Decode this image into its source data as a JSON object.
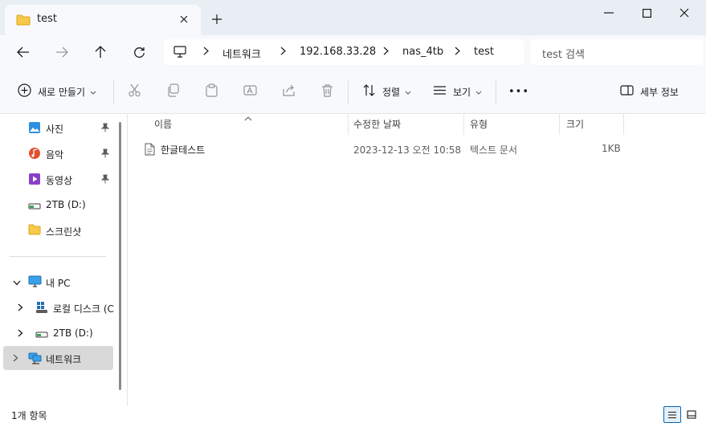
{
  "window": {
    "tab_title": "test",
    "controls": {
      "minimize_icon": "minimize-icon",
      "maximize_icon": "maximize-icon",
      "close_icon": "close-icon"
    }
  },
  "address_bar": {
    "breadcrumbs": [
      "네트워크",
      "192.168.33.28",
      "nas_4tb",
      "test"
    ],
    "search_placeholder": "test 검색"
  },
  "command_bar": {
    "new_label": "새로 만들기",
    "sort_label": "정렬",
    "view_label": "보기",
    "more_label": "•••",
    "details_label": "세부 정보"
  },
  "sidebar": {
    "quick_access": [
      {
        "label": "사진",
        "icon": "pictures-icon",
        "pinned": true
      },
      {
        "label": "음악",
        "icon": "music-icon",
        "pinned": true
      },
      {
        "label": "동영상",
        "icon": "videos-icon",
        "pinned": true
      },
      {
        "label": "2TB (D:)",
        "icon": "drive-icon",
        "pinned": false
      },
      {
        "label": "스크린샷",
        "icon": "folder-icon",
        "pinned": false
      }
    ],
    "this_pc": {
      "label": "내 PC"
    },
    "drives": [
      {
        "label": "로컬 디스크 (C",
        "icon": "windows-drive-icon"
      },
      {
        "label": "2TB (D:)",
        "icon": "drive-icon"
      }
    ],
    "network": {
      "label": "네트워크",
      "selected": true
    }
  },
  "file_list": {
    "columns": [
      "이름",
      "수정한 날짜",
      "유형",
      "크기"
    ],
    "rows": [
      {
        "name": "한글테스트",
        "modified": "2023-12-13 오전 10:58",
        "type": "텍스트 문서",
        "size": "1KB"
      }
    ]
  },
  "status_bar": {
    "item_count": "1개 항목"
  },
  "colors": {
    "accent": "#0067c0",
    "titlebar": "#e9eef5",
    "toolbar": "#f7f9fc",
    "selected": "#d9d9d9",
    "folder": "#f7c948"
  }
}
